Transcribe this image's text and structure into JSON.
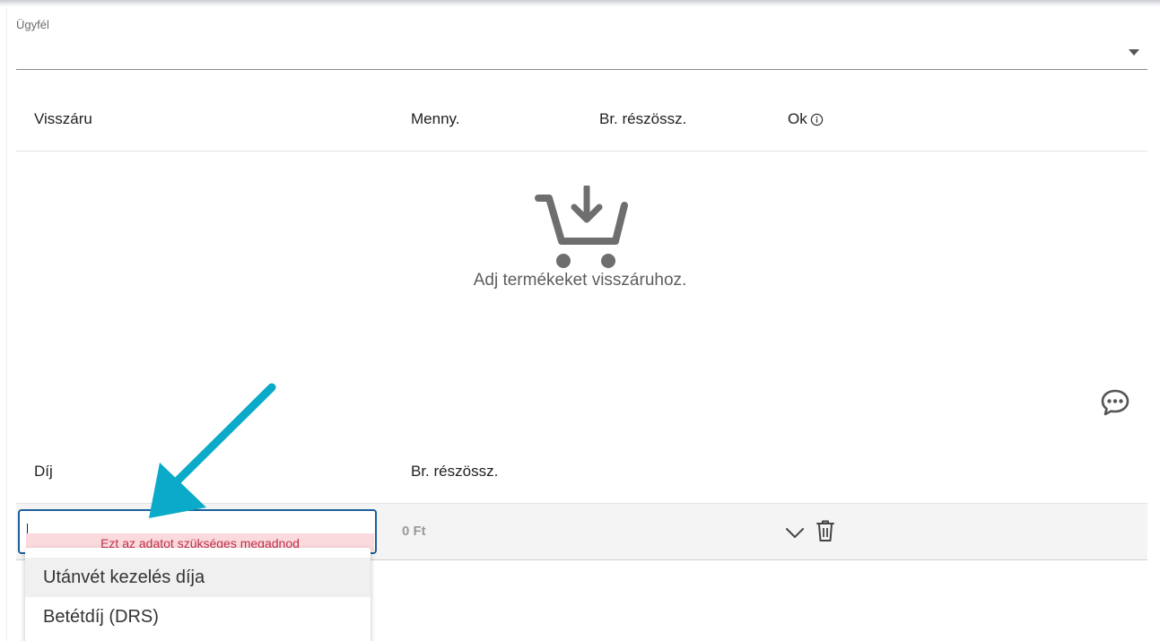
{
  "customer": {
    "label": "Ügyfél",
    "value": ""
  },
  "returns_table": {
    "columns": [
      "Visszáru",
      "Menny.",
      "Br. részössz.",
      "Ok"
    ],
    "empty_message": "Adj termékeket visszáruhoz."
  },
  "fees": {
    "columns": [
      "Díj",
      "Br. részössz."
    ],
    "row": {
      "input_value": "",
      "error": "Ezt az adatot szükséges megadnod",
      "amount": "0 Ft"
    },
    "options": [
      "Utánvét kezelés díja",
      "Betétdíj (DRS)"
    ]
  },
  "colors": {
    "accent_border": "#1f5f9a",
    "error_bg": "#fadadd",
    "error_text": "#c0304a",
    "annotation_arrow": "#0aaac8"
  },
  "icons": [
    "chevron-down-icon",
    "info-icon",
    "cart-download-icon",
    "comment-icon",
    "chevron-down-icon",
    "trash-icon"
  ]
}
